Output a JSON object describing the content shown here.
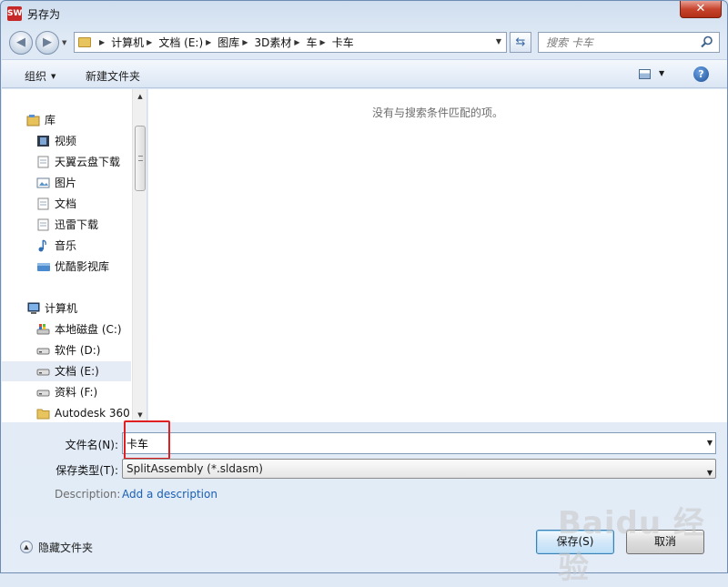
{
  "window": {
    "title": "另存为",
    "app_icon_text": "SW"
  },
  "address": {
    "crumbs": [
      "计算机",
      "文档 (E:)",
      "图库",
      "3D素材",
      "车",
      "卡车"
    ]
  },
  "search": {
    "placeholder": "搜索 卡车"
  },
  "toolbar": {
    "organize_label": "组织",
    "new_folder_label": "新建文件夹"
  },
  "nav": {
    "items": [
      {
        "label": "库",
        "icon": "library-icon"
      },
      {
        "label": "视频",
        "icon": "video-icon"
      },
      {
        "label": "天翼云盘下载",
        "icon": "document-icon"
      },
      {
        "label": "图片",
        "icon": "pictures-icon"
      },
      {
        "label": "文档",
        "icon": "document-icon"
      },
      {
        "label": "迅雷下载",
        "icon": "document-icon"
      },
      {
        "label": "音乐",
        "icon": "music-icon"
      },
      {
        "label": "优酷影视库",
        "icon": "youku-icon"
      },
      {
        "label": "计算机",
        "icon": "computer-icon"
      },
      {
        "label": "本地磁盘 (C:)",
        "icon": "system-drive-icon"
      },
      {
        "label": "软件 (D:)",
        "icon": "drive-icon"
      },
      {
        "label": "文档 (E:)",
        "icon": "drive-icon",
        "selected": true
      },
      {
        "label": "资料 (F:)",
        "icon": "drive-icon"
      },
      {
        "label": "Autodesk 360",
        "icon": "folder-icon"
      }
    ]
  },
  "content": {
    "empty_message": "没有与搜索条件匹配的项。"
  },
  "form": {
    "filename_label": "文件名(N):",
    "filename_value": "卡车",
    "type_label": "保存类型(T):",
    "type_value": "SplitAssembly (*.sldasm)",
    "description_label": "Description:",
    "description_link": "Add a description"
  },
  "footer": {
    "hide_folders_label": "隐藏文件夹",
    "save_label": "保存(S)",
    "cancel_label": "取消"
  },
  "watermark": "Baidu 经验",
  "colors": {
    "accent": "#1a5fb4",
    "highlight": "#e02020",
    "close": "#c7442d"
  }
}
